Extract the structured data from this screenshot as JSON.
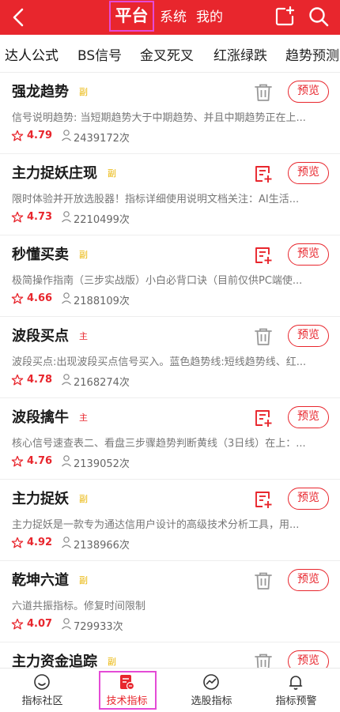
{
  "header": {
    "tabs": [
      {
        "label": "平台",
        "active": true
      },
      {
        "label": "系统",
        "active": false
      },
      {
        "label": "我的",
        "active": false
      }
    ],
    "icons": [
      "back-arrow-icon",
      "add-square-icon",
      "search-icon"
    ]
  },
  "subtabs": [
    {
      "label": "达人公式",
      "active": true
    },
    {
      "label": "BS信号",
      "active": false
    },
    {
      "label": "金叉死叉",
      "active": false
    },
    {
      "label": "红涨绿跌",
      "active": false
    },
    {
      "label": "趋势预测",
      "active": false
    }
  ],
  "list": [
    {
      "title": "强龙趋势",
      "tag": "副",
      "tag_type": "fu",
      "desc": "信号说明趋势: 当短期趋势大于中期趋势、并且中期趋势正在上...",
      "rating": "4.79",
      "users": "2439172次",
      "action": "delete",
      "preview": "预览"
    },
    {
      "title": "主力捉妖庄现",
      "tag": "副",
      "tag_type": "fu",
      "desc": "限时体验并开放选股器！指标详细使用说明文档关注：AI生活...",
      "rating": "4.73",
      "users": "2210499次",
      "action": "add",
      "preview": "预览"
    },
    {
      "title": "秒懂买卖",
      "tag": "副",
      "tag_type": "fu",
      "desc": "极简操作指南（三步实战版）小白必背口诀（目前仅供PC端使...",
      "rating": "4.66",
      "users": "2188109次",
      "action": "add",
      "preview": "预览"
    },
    {
      "title": "波段买点",
      "tag": "主",
      "tag_type": "zhu",
      "desc": "波段买点:出现波段买点信号买入。蓝色趋势线:短线趋势线、红...",
      "rating": "4.78",
      "users": "2168274次",
      "action": "delete",
      "preview": "预览"
    },
    {
      "title": "波段擒牛",
      "tag": "主",
      "tag_type": "zhu",
      "desc": "核心信号速查表二、看盘三步骤趋势判断黄线（3日线）在上：...",
      "rating": "4.76",
      "users": "2139052次",
      "action": "add",
      "preview": "预览"
    },
    {
      "title": "主力捉妖",
      "tag": "副",
      "tag_type": "fu",
      "desc": "主力捉妖是一款专为通达信用户设计的高级技术分析工具，用...",
      "rating": "4.92",
      "users": "2138966次",
      "action": "add",
      "preview": "预览"
    },
    {
      "title": "乾坤六道",
      "tag": "副",
      "tag_type": "fu",
      "desc": "六道共振指标。修复时间限制",
      "rating": "4.07",
      "users": "729933次",
      "action": "delete",
      "preview": "预览"
    },
    {
      "title": "主力资金追踪",
      "tag": "副",
      "tag_type": "fu",
      "desc": "",
      "rating": "",
      "users": "",
      "action": "delete",
      "preview": "预览"
    }
  ],
  "bottom_nav": [
    {
      "label": "指标社区",
      "icon": "smile-icon",
      "active": false
    },
    {
      "label": "技术指标",
      "icon": "indicator-doc-icon",
      "active": true
    },
    {
      "label": "选股指标",
      "icon": "chart-circle-icon",
      "active": false
    },
    {
      "label": "指标预警",
      "icon": "bell-icon",
      "active": false
    }
  ],
  "colors": {
    "brand": "#e8262d",
    "tag_fu": "#e9b400",
    "highlight": "#e44bd6"
  }
}
